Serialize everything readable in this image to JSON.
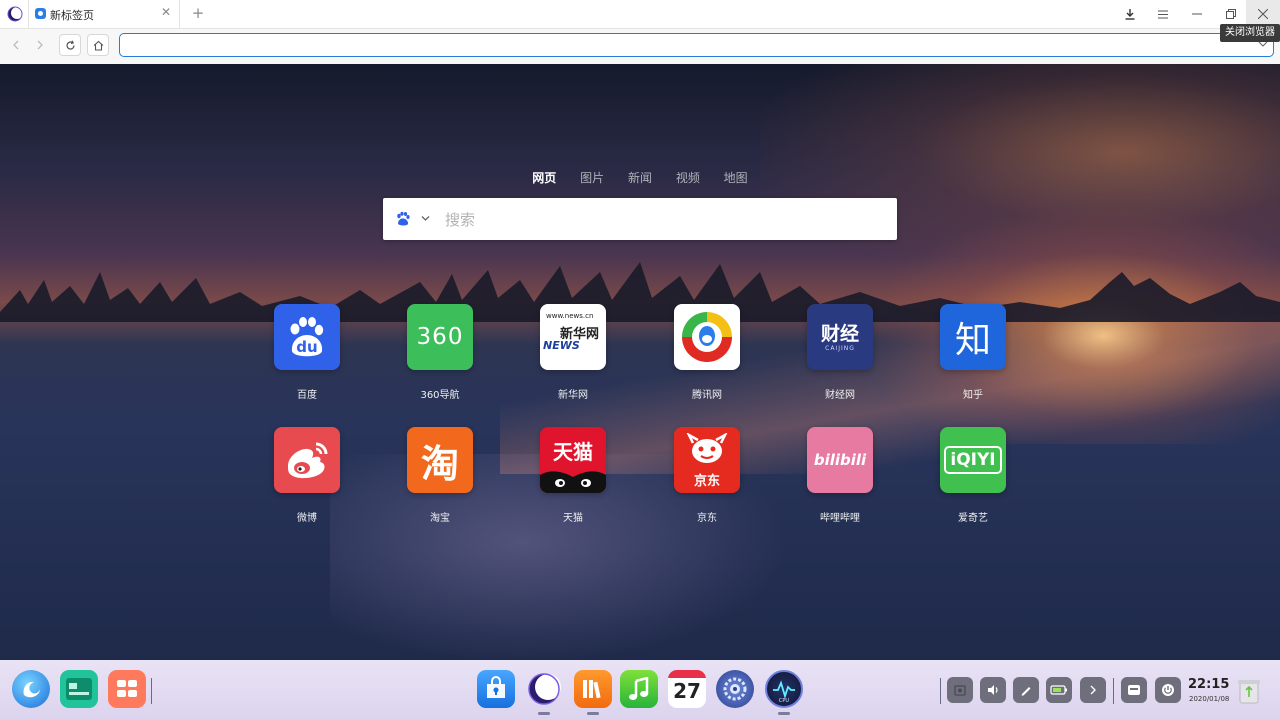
{
  "browser": {
    "tab_title": "新标签页",
    "address_value": "",
    "close_tooltip": "关闭浏览器"
  },
  "search": {
    "tabs": [
      "网页",
      "图片",
      "新闻",
      "视频",
      "地图"
    ],
    "active_tab": "网页",
    "placeholder": "搜索",
    "engine_icon": "baidu-paw-icon"
  },
  "sites": [
    {
      "label": "百度",
      "tile_text": "du",
      "color": "#2f62e8",
      "icon": "baidu-paw-icon"
    },
    {
      "label": "360导航",
      "tile_text": "360",
      "color": "#3cbf5b",
      "icon": "360-logo-icon"
    },
    {
      "label": "新华网",
      "tile_text": "新华网",
      "tile_sub": "NEWS",
      "tile_top": "www.news.cn",
      "color": "#ffffff",
      "icon": "xinhua-news-icon"
    },
    {
      "label": "腾讯网",
      "tile_text": "",
      "color": "#ffffff",
      "icon": "tencent-news-icon"
    },
    {
      "label": "财经网",
      "tile_text": "财经",
      "tile_sub": "CAIJING",
      "color": "#2a3a80",
      "icon": "caijing-icon"
    },
    {
      "label": "知乎",
      "tile_text": "知",
      "color": "#1f66dd",
      "icon": "zhihu-icon"
    },
    {
      "label": "微博",
      "tile_text": "",
      "color": "#e84b4f",
      "icon": "weibo-icon"
    },
    {
      "label": "淘宝",
      "tile_text": "淘",
      "color": "#f2681c",
      "icon": "taobao-icon"
    },
    {
      "label": "天猫",
      "tile_text": "天猫",
      "color": "#e0152d",
      "icon": "tmall-icon"
    },
    {
      "label": "京东",
      "tile_text": "京东",
      "color": "#e52a20",
      "icon": "jd-icon"
    },
    {
      "label": "哔哩哔哩",
      "tile_text": "bilibili",
      "color": "#e77aa0",
      "icon": "bilibili-icon"
    },
    {
      "label": "爱奇艺",
      "tile_text": "iQIYI",
      "color": "#3fc04f",
      "icon": "iqiyi-icon"
    }
  ],
  "dock": {
    "left_apps": [
      "launcher-icon",
      "multitask-view-icon",
      "workspace-icon"
    ],
    "apps": [
      "app-store-icon",
      "browser-icon",
      "music-library-icon",
      "music-icon",
      "calendar-icon",
      "settings-icon",
      "system-monitor-icon"
    ],
    "calendar_day": "27",
    "monitor_text": "CPU",
    "tray": [
      "screenshot-icon",
      "volume-icon",
      "pen-icon",
      "battery-icon",
      "expand-arrow-icon",
      "keyboard-icon",
      "power-icon"
    ],
    "time": "22:15",
    "date": "2020/01/08"
  }
}
